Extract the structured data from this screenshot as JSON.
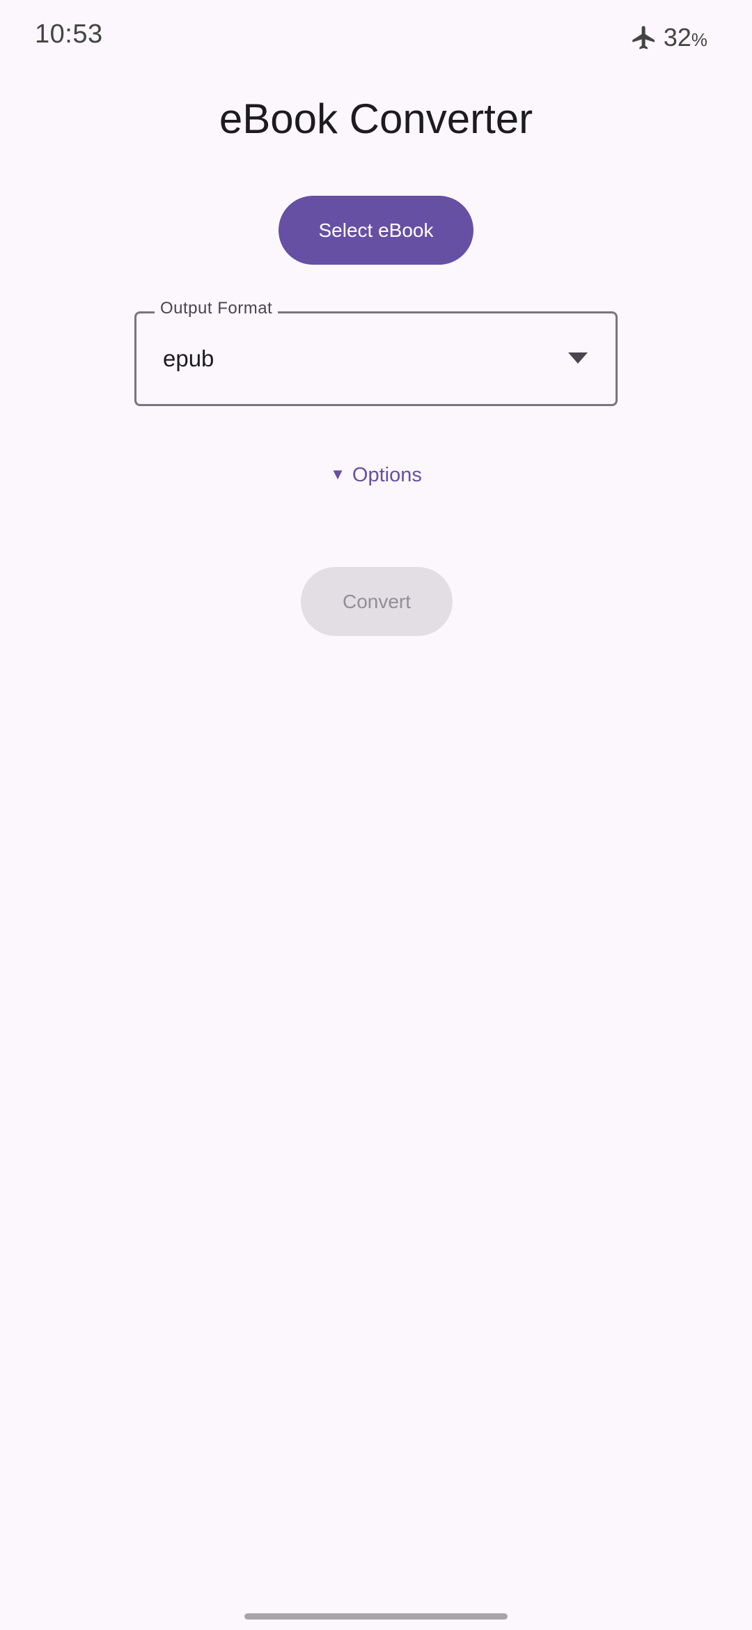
{
  "status_bar": {
    "time": "10:53",
    "battery_value": "32",
    "battery_unit": "%",
    "icons": [
      "airplane-mode-icon"
    ]
  },
  "app": {
    "title": "eBook Converter"
  },
  "select_button": {
    "label": "Select eBook"
  },
  "output_format": {
    "label": "Output Format",
    "selected_value": "epub"
  },
  "options": {
    "toggle_symbol": "▼",
    "label": "Options"
  },
  "convert_button": {
    "label": "Convert",
    "enabled": false
  },
  "colors": {
    "primary": "#6650a4",
    "background": "#fcf7fc",
    "disabled_button_bg": "#e2dee4",
    "disabled_button_text": "#928d96",
    "outline": "#79747e"
  }
}
